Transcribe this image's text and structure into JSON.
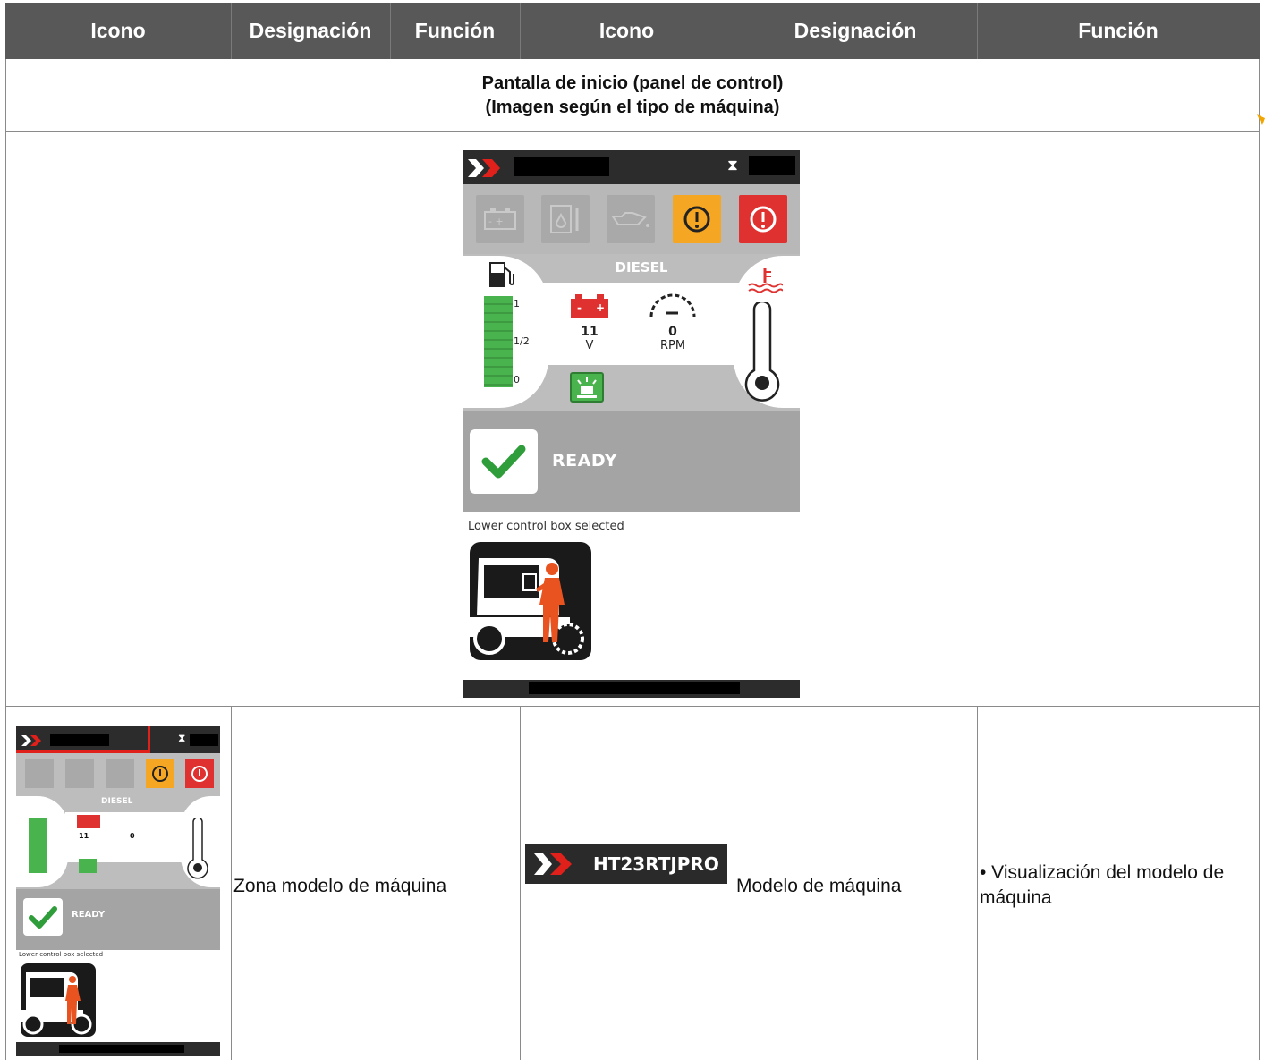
{
  "header": {
    "col1": "Icono",
    "col2": "Designación",
    "col3": "Función",
    "col4": "Icono",
    "col5": "Designación",
    "col6": "Función"
  },
  "section": {
    "line1": "Pantalla de inicio (panel de control)",
    "line2": "(Imagen según el tipo de máquina)"
  },
  "screen": {
    "fuel_label": "DIESEL",
    "tick_full": "1",
    "tick_half": "1/2",
    "tick_zero": "0",
    "voltage_value": "11",
    "voltage_unit": "V",
    "rpm_value": "0",
    "rpm_unit": "RPM",
    "status": "READY",
    "control_text": "Lower control box selected"
  },
  "row1": {
    "designation_left": "Zona modelo de máquina",
    "logo_text": "HT23RTJPRO",
    "designation_right": "Modelo de máquina",
    "function": "• Visualización del modelo de máquina"
  },
  "colors": {
    "header_bg": "#585858",
    "warn_orange": "#f5a623",
    "alarm_red": "#e03131",
    "fuel_green": "#49b34d",
    "highlight_red": "#e0201a",
    "operator_orange": "#e9531f"
  }
}
